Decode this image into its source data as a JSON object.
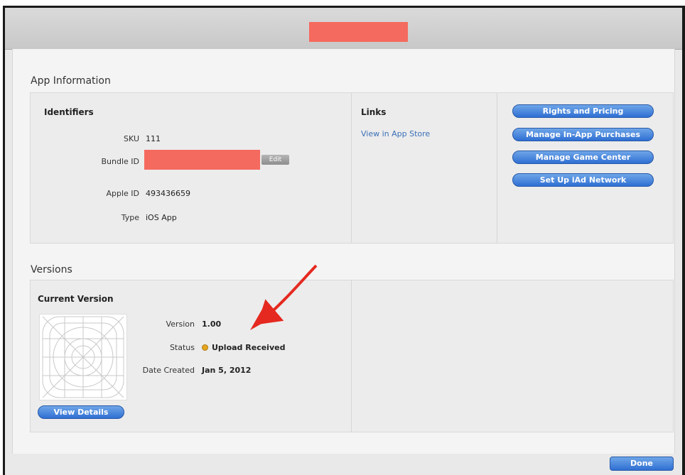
{
  "app_information": {
    "title": "App Information",
    "identifiers": {
      "heading": "Identifiers",
      "sku_label": "SKU",
      "sku_value": "111",
      "bundle_id_label": "Bundle ID",
      "edit_label": "Edit",
      "apple_id_label": "Apple ID",
      "apple_id_value": "493436659",
      "type_label": "Type",
      "type_value": "iOS App"
    },
    "links": {
      "heading": "Links",
      "view_in_app_store": "View in App Store"
    },
    "actions": {
      "rights_and_pricing": "Rights and Pricing",
      "manage_in_app_purchases": "Manage In-App Purchases",
      "manage_game_center": "Manage Game Center",
      "set_up_iad_network": "Set Up iAd Network"
    }
  },
  "versions": {
    "title": "Versions",
    "current_version": {
      "heading": "Current Version",
      "version_label": "Version",
      "version_value": "1.00",
      "status_label": "Status",
      "status_value": "Upload Received",
      "date_created_label": "Date Created",
      "date_created_value": "Jan 5, 2012",
      "view_details_label": "View Details"
    }
  },
  "footer": {
    "done_label": "Done"
  },
  "colors": {
    "redaction": "#f56a5e",
    "button_blue": "#2f6fd3",
    "link_blue": "#3a6fb8",
    "status_yellow": "#e5a620",
    "arrow_red": "#e52920"
  },
  "icons": {
    "status": "status-dot-icon",
    "app_icon": "app-icon-placeholder",
    "annotation": "red-arrow-icon"
  }
}
